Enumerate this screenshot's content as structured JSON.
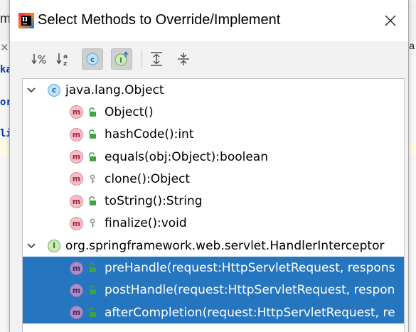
{
  "dialog": {
    "title": "Select Methods to Override/Implement"
  },
  "background": {
    "tokens": [
      "m",
      "ka",
      "or",
      "li"
    ],
    "tab_fragment": "va"
  },
  "colors": {
    "selection": "#2675bf",
    "method_icon": "#f4bfc8",
    "class_icon": "#bfe4f8",
    "interface_icon": "#cde9c0",
    "public_access": "#3fa33f"
  },
  "toolbar": {
    "buttons": [
      {
        "name": "sort-by-visibility",
        "icon": "sort-visibility-icon",
        "active": false
      },
      {
        "name": "sort-alphabetically",
        "icon": "sort-alpha-icon",
        "active": false
      },
      {
        "name": "show-classes",
        "icon": "class-icon",
        "active": true
      },
      {
        "name": "show-interfaces",
        "icon": "interface-up-icon",
        "active": true
      },
      {
        "name": "expand-all",
        "icon": "expand-all-icon",
        "active": false
      },
      {
        "name": "collapse-all",
        "icon": "collapse-all-icon",
        "active": false
      }
    ]
  },
  "tree": {
    "groups": [
      {
        "label": "java.lang.Object",
        "kind": "class",
        "kind_letter": "c",
        "expanded": true,
        "members": [
          {
            "label": "Object()",
            "access": "public",
            "selected": false
          },
          {
            "label": "hashCode():int",
            "access": "public",
            "selected": false
          },
          {
            "label": "equals(obj:Object):boolean",
            "access": "public",
            "selected": false
          },
          {
            "label": "clone():Object",
            "access": "protected",
            "selected": false
          },
          {
            "label": "toString():String",
            "access": "public",
            "selected": false
          },
          {
            "label": "finalize():void",
            "access": "protected",
            "selected": false
          }
        ]
      },
      {
        "label": "org.springframework.web.servlet.HandlerInterceptor",
        "kind": "interface",
        "kind_letter": "I",
        "expanded": true,
        "members": [
          {
            "label": "preHandle(request:HttpServletRequest, respons",
            "access": "public",
            "selected": true
          },
          {
            "label": "postHandle(request:HttpServletRequest, respon",
            "access": "public",
            "selected": true
          },
          {
            "label": "afterCompletion(request:HttpServletRequest, re",
            "access": "public",
            "selected": true
          }
        ]
      }
    ],
    "method_letter": "m"
  }
}
